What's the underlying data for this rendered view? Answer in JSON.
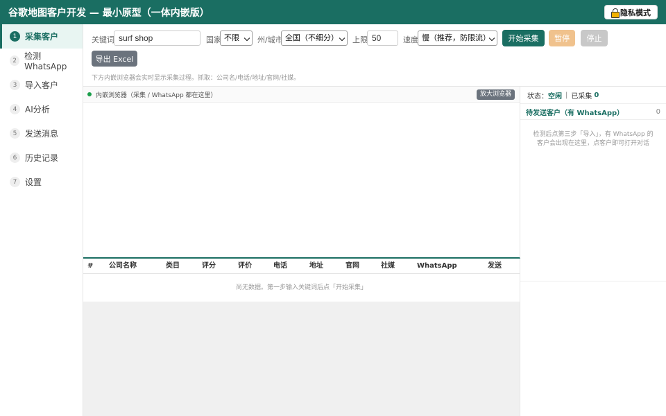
{
  "header": {
    "title": "谷歌地图客户开发 — 最小原型（一体内嵌版）",
    "privacy_button": "隐私模式"
  },
  "sidebar": {
    "items": [
      {
        "num": "1",
        "label": "采集客户",
        "active": true
      },
      {
        "num": "2",
        "label": "检测 WhatsApp",
        "active": false
      },
      {
        "num": "3",
        "label": "导入客户",
        "active": false
      },
      {
        "num": "4",
        "label": "AI分析",
        "active": false
      },
      {
        "num": "5",
        "label": "发送消息",
        "active": false
      },
      {
        "num": "6",
        "label": "历史记录",
        "active": false
      },
      {
        "num": "7",
        "label": "设置",
        "active": false
      }
    ]
  },
  "toolbar": {
    "keyword_label": "关键词",
    "keyword_value": "surf shop",
    "country_label": "国家",
    "country_value": "不限",
    "region_label": "州/城市",
    "region_value": "全国（不细分）",
    "limit_label": "上限",
    "limit_value": "50",
    "speed_label": "速度",
    "speed_value": "慢（推荐，防限流）",
    "start_button": "开始采集",
    "pause_button": "暂停",
    "stop_button": "停止",
    "export_button": "导出 Excel",
    "hint": "下方内嵌浏览器会实时显示采集过程。抓取：公司名/电话/地址/官网/社媒。"
  },
  "browser": {
    "label": "内嵌浏览器（采集 / WhatsApp 都在这里）",
    "zoom_button": "放大浏览器"
  },
  "table": {
    "columns": [
      "#",
      "公司名称",
      "类目",
      "评分",
      "评价",
      "电话",
      "地址",
      "官网",
      "社媒",
      "WhatsApp",
      "发送"
    ],
    "empty_text": "尚无数据。第一步输入关键词后点「开始采集」"
  },
  "right_panel": {
    "status_label": "状态：",
    "status_value": "空闲",
    "collected_label": "已采集",
    "collected_count": "0",
    "queue_title": "待发送客户（有 WhatsApp）",
    "queue_count": "0",
    "queue_hint": "检测后点第三步「导入」，有 WhatsApp 的客户会出现在这里，点客户即可打开对话"
  },
  "colors": {
    "accent": "#1a6e62",
    "pause": "#f0c28d",
    "stop": "#c8c8c8",
    "export": "#6b737d"
  }
}
